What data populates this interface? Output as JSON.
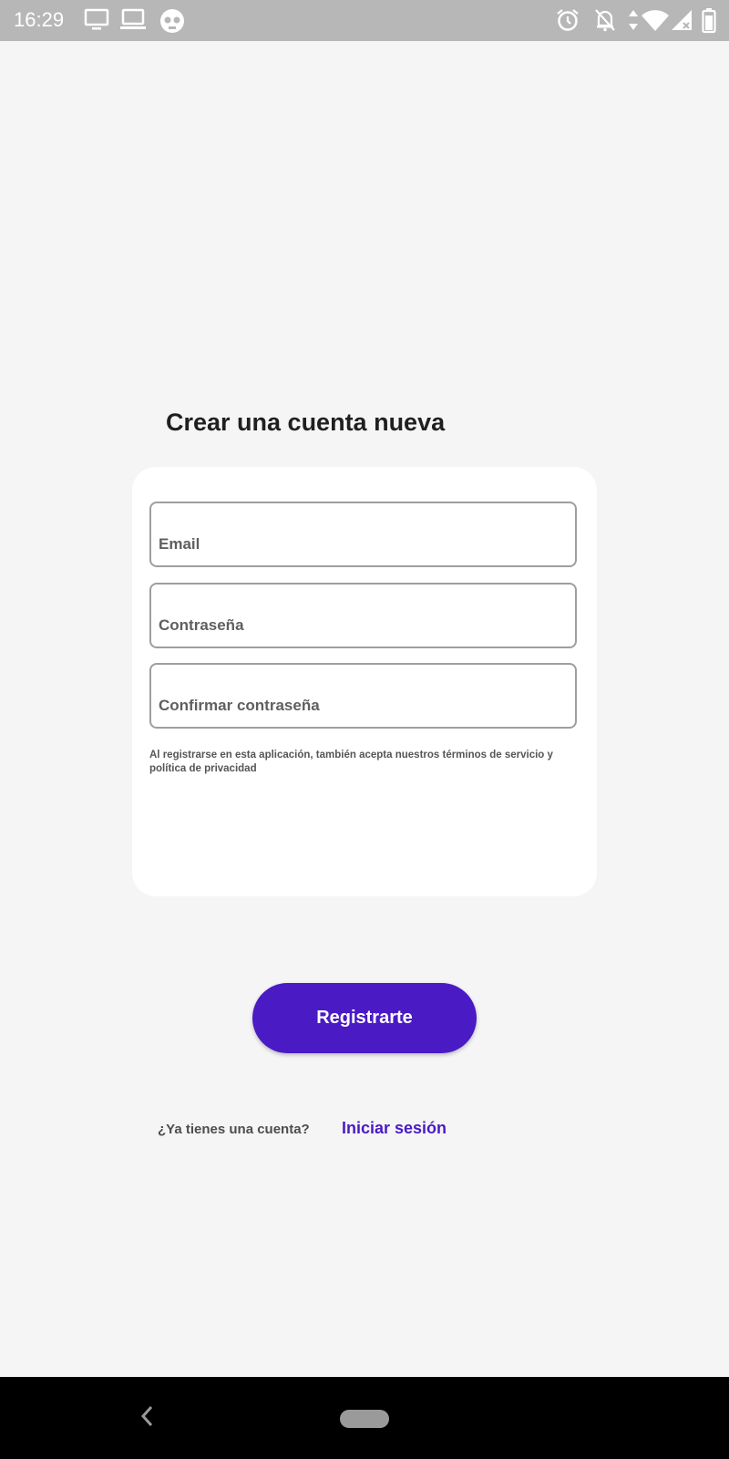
{
  "status_bar": {
    "time": "16:29",
    "left_icons": [
      "tv-icon",
      "laptop-icon",
      "skull-icon"
    ],
    "right_icons": [
      "alarm-icon",
      "bell-off-icon",
      "data-arrows-icon",
      "wifi-icon",
      "signal-icon",
      "battery-icon"
    ]
  },
  "page": {
    "title": "Crear una cuenta nueva"
  },
  "form": {
    "email_placeholder": "Email",
    "password_placeholder": "Contraseña",
    "confirm_placeholder": "Confirmar contraseña",
    "terms_text": "Al registrarse en esta aplicación, también acepta nuestros términos de servicio y política de privacidad"
  },
  "actions": {
    "register_label": "Registrarte",
    "have_account_text": "¿Ya tienes una cuenta?",
    "login_label": "Iniciar sesión"
  },
  "nav_bar": {
    "icons": [
      "back-icon",
      "home-pill-icon"
    ]
  },
  "colors": {
    "accent": "#4a1ac5",
    "background": "#f5f5f5",
    "status_bar": "#b7b7b7"
  }
}
